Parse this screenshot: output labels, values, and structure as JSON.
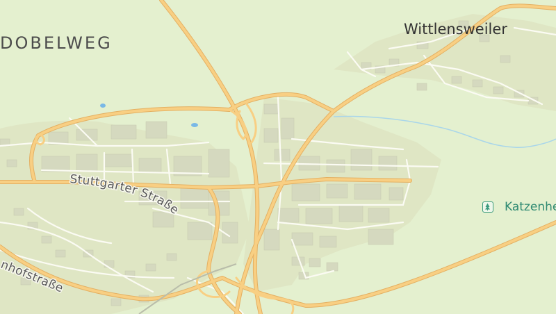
{
  "map": {
    "labels": {
      "district": "DOBELWEG",
      "town": "Wittlensweiler",
      "poi": "Katzenhe"
    },
    "streets": {
      "stuttgarter": "Stuttgarter Straße",
      "bahnhof": "nhofstraße"
    },
    "icons": {
      "poi": "tree-icon"
    },
    "colors": {
      "background": "#e4f0cf",
      "major_road": "#f7c772",
      "road_casing": "#e5ad52",
      "minor_road": "#fbfbf3",
      "buildings": "#d6d9c2",
      "water": "#79b8e6",
      "poi": "#2f8a72"
    }
  }
}
